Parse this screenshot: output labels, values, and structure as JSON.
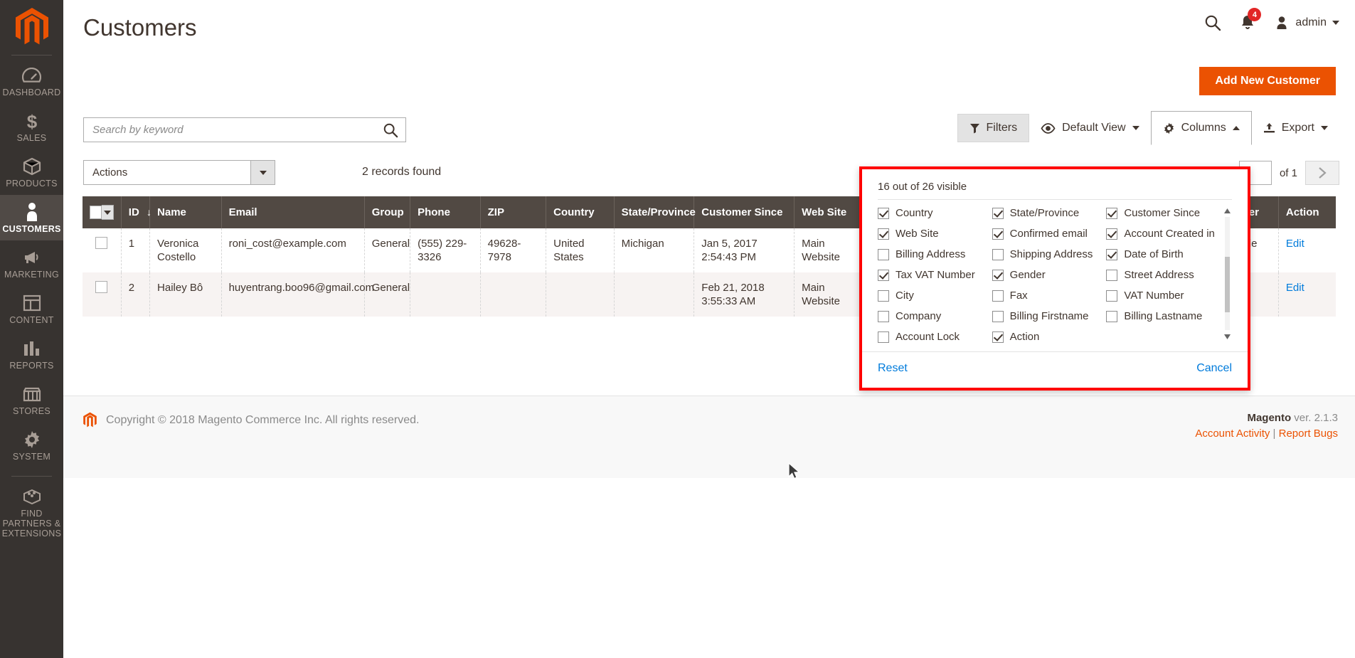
{
  "sidebar": {
    "logo": "magento-logo",
    "items": [
      {
        "label": "Dashboard",
        "icon": "dashboard-icon",
        "active": false
      },
      {
        "label": "Sales",
        "icon": "dollar-icon",
        "active": false
      },
      {
        "label": "Products",
        "icon": "box-icon",
        "active": false
      },
      {
        "label": "Customers",
        "icon": "person-icon",
        "active": true
      },
      {
        "label": "Marketing",
        "icon": "megaphone-icon",
        "active": false
      },
      {
        "label": "Content",
        "icon": "layout-icon",
        "active": false
      },
      {
        "label": "Reports",
        "icon": "bar-chart-icon",
        "active": false
      },
      {
        "label": "Stores",
        "icon": "storefront-icon",
        "active": false
      },
      {
        "label": "System",
        "icon": "gear-icon",
        "active": false
      },
      {
        "label": "Find Partners & Extensions",
        "icon": "puzzle-brick-icon",
        "active": false
      }
    ]
  },
  "header": {
    "title": "Customers",
    "search_icon": "search-icon",
    "notifications_icon": "bell-icon",
    "notifications_count": "4",
    "avatar_icon": "user-avatar-icon",
    "admin_label": "admin"
  },
  "action_bar": {
    "add_new_customer": "Add New Customer"
  },
  "toolbar": {
    "search_placeholder": "Search by keyword",
    "search_value": "",
    "search_icon": "search-icon",
    "filters_label": "Filters",
    "filters_icon": "funnel-icon",
    "view_label": "Default View",
    "view_icon": "eye-icon",
    "columns_label": "Columns",
    "columns_icon": "gear-icon",
    "export_label": "Export",
    "export_icon": "upload-icon"
  },
  "actions_row": {
    "actions_label": "Actions",
    "records_found": "2 records found",
    "pager_value": "",
    "pager_of": "of 1",
    "next_icon": "chevron-right-icon"
  },
  "columns_panel": {
    "visible_count": "16 out of 26 visible",
    "options": [
      {
        "label": "Country",
        "checked": true
      },
      {
        "label": "State/Province",
        "checked": true
      },
      {
        "label": "Customer Since",
        "checked": true
      },
      {
        "label": "Web Site",
        "checked": true
      },
      {
        "label": "Confirmed email",
        "checked": true
      },
      {
        "label": "Account Created in",
        "checked": true
      },
      {
        "label": "Billing Address",
        "checked": false
      },
      {
        "label": "Shipping Address",
        "checked": false
      },
      {
        "label": "Date of Birth",
        "checked": true
      },
      {
        "label": "Tax VAT Number",
        "checked": true
      },
      {
        "label": "Gender",
        "checked": true
      },
      {
        "label": "Street Address",
        "checked": false
      },
      {
        "label": "City",
        "checked": false
      },
      {
        "label": "Fax",
        "checked": false
      },
      {
        "label": "VAT Number",
        "checked": false
      },
      {
        "label": "Company",
        "checked": false
      },
      {
        "label": "Billing Firstname",
        "checked": false
      },
      {
        "label": "Billing Lastname",
        "checked": false
      },
      {
        "label": "Account Lock",
        "checked": false
      },
      {
        "label": "Action",
        "checked": true
      }
    ],
    "reset_label": "Reset",
    "cancel_label": "Cancel"
  },
  "grid": {
    "columns": [
      "ID",
      "Name",
      "Email",
      "Group",
      "Phone",
      "ZIP",
      "Country",
      "State/Province",
      "Customer Since",
      "Web Site",
      "Confirmed email",
      "Account Created in",
      "Date of Birth",
      "Tax VAT Number",
      "Gender",
      "Action"
    ],
    "sort_column": "ID",
    "sort_direction": "descending",
    "rows": [
      {
        "id": "1",
        "name": "Veronica Costello",
        "email": "roni_cost@example.com",
        "group": "General",
        "phone": "(555) 229-3326",
        "zip": "49628-7978",
        "country": "United States",
        "state": "Michigan",
        "customer_since": "Jan 5, 2017 2:54:43 PM",
        "web_site": "Main Website",
        "gender": "Female",
        "action": "Edit"
      },
      {
        "id": "2",
        "name": "Hailey Bô",
        "email": "huyentrang.boo96@gmail.com",
        "group": "General",
        "phone": "",
        "zip": "",
        "country": "",
        "state": "",
        "customer_since": "Feb 21, 2018 3:55:33 AM",
        "web_site": "Main Website",
        "gender": "",
        "action": "Edit"
      }
    ]
  },
  "footer": {
    "copyright": "Copyright © 2018 Magento Commerce Inc. All rights reserved.",
    "version_brand": "Magento",
    "version_text": " ver. 2.1.3",
    "account_activity": "Account Activity",
    "separator": "|",
    "report_bugs": "Report Bugs"
  },
  "colors": {
    "accent": "#eb5202",
    "sidebar": "#373330",
    "table_header": "#514943",
    "link": "#007bdb",
    "highlight_border": "#ff0000",
    "badge": "#e22626"
  }
}
